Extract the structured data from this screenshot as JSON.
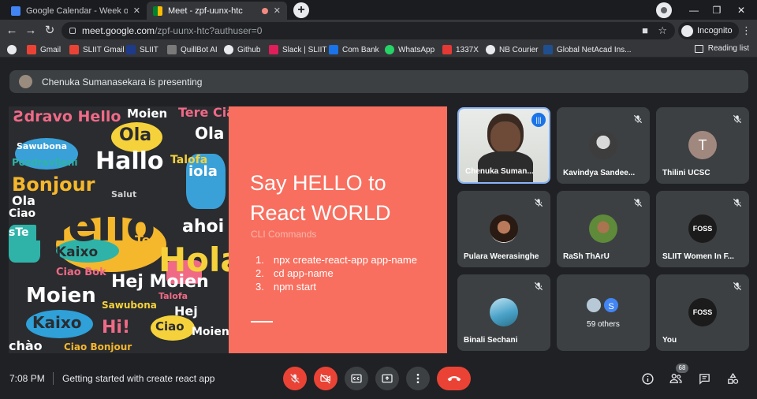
{
  "browser": {
    "tabs": [
      {
        "title": "Google Calendar - Week of Augu"
      },
      {
        "title": "Meet - zpf-uunx-htc"
      }
    ],
    "url_host": "meet.google.com",
    "url_path": "/zpf-uunx-htc?authuser=0",
    "profile_label": "Incognito",
    "bookmarks": [
      "Gmail",
      "SLIIT Gmail",
      "SLIIT",
      "QuillBot AI",
      "Github",
      "Slack | SLIIT",
      "Com Bank",
      "WhatsApp",
      "1337X",
      "NB Courier",
      "Global NetAcad Ins..."
    ],
    "reading_list": "Reading list"
  },
  "meet": {
    "presenting_banner": "Chenuka Sumanasekara is presenting",
    "slide": {
      "title_line1": "Say HELLO to",
      "title_line2": "React WORLD",
      "subtitle": "CLI Commands",
      "steps": [
        {
          "num": "1.",
          "text": "npx create-react-app app-name"
        },
        {
          "num": "2.",
          "text": "cd app-name"
        },
        {
          "num": "3.",
          "text": "npm start"
        }
      ]
    },
    "participants": [
      {
        "name": "Chenuka Suman...",
        "speaking": true
      },
      {
        "name": "Kavindya Sandee...",
        "muted": true
      },
      {
        "name": "Thilini UCSC",
        "initial": "T",
        "muted": true
      },
      {
        "name": "Pulara Weerasinghe",
        "muted": true
      },
      {
        "name": "RaSh ThArU",
        "muted": true
      },
      {
        "name": "SLIIT Women In F...",
        "muted": true
      },
      {
        "name": "Binali Sechani",
        "muted": true
      },
      {
        "name": "59 others",
        "initial": "S"
      },
      {
        "name": "You",
        "muted": true
      }
    ],
    "logo_text": "FOSS",
    "time": "7:08 PM",
    "meeting_title": "Getting started with create react app",
    "participant_count": "68",
    "colors": {
      "accent_red": "#ea4335",
      "slide_bg": "#f86f5f",
      "tile_bg": "#3c4043"
    }
  }
}
